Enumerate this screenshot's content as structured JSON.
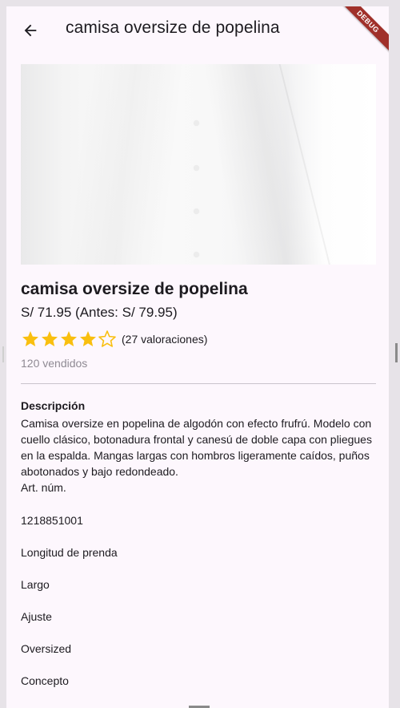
{
  "appbar": {
    "title": "camisa oversize de popelina",
    "debug_label": "DEBUG"
  },
  "icons": {
    "back": "arrow-back-icon",
    "star_full": "star-filled-icon",
    "star_empty": "star-outline-icon"
  },
  "colors": {
    "background": "#fdf7fd",
    "text": "#1d1b20",
    "muted": "#8f8a93",
    "star": "#f9bf0f",
    "divider": "#c9c3cc",
    "debug_ribbon": "#a0302a"
  },
  "product": {
    "title": "camisa oversize de popelina",
    "price": "S/ 71.95 (Antes: S/ 79.95)",
    "rating": 4,
    "rating_max": 5,
    "rating_count": "(27 valoraciones)",
    "sold": "120 vendidos"
  },
  "description": {
    "heading": "Descripción",
    "text": "Camisa oversize en popelina de algodón con efecto frufrú. Modelo con cuello clásico, botonadura frontal y canesú de doble capa con pliegues en la espalda. Mangas largas con hombros ligeramente caídos, puños abotonados y bajo redondeado.\nArt. núm.",
    "specs": [
      "1218851001",
      "Longitud de prenda",
      "Largo",
      "Ajuste",
      "Oversized",
      "Concepto"
    ]
  }
}
